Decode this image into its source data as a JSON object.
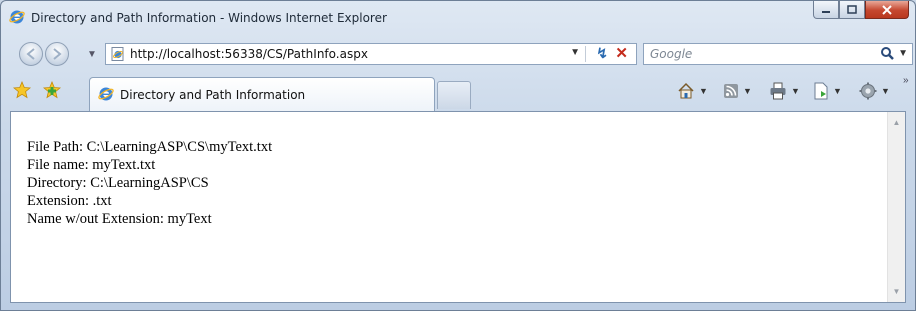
{
  "window": {
    "title": "Directory and Path Information - Windows Internet Explorer"
  },
  "nav": {
    "address": "http://localhost:56338/CS/PathInfo.aspx",
    "search_placeholder": "Google"
  },
  "tab": {
    "label": "Directory and Path Information"
  },
  "icons": {
    "favorites": "favorites-star-icon",
    "add_favorites": "add-favorites-icon",
    "home": "home-icon",
    "feeds": "feeds-icon",
    "print": "print-icon",
    "page": "page-icon",
    "tools": "tools-gear-icon"
  },
  "content": {
    "lines": [
      "File Path: C:\\LearningASP\\CS\\myText.txt",
      "File name: myText.txt",
      "Directory: C:\\LearningASP\\CS",
      "Extension: .txt",
      "Name w/out Extension: myText"
    ]
  },
  "colors": {
    "close_button": "#c5472f",
    "ie_blue": "#2a6ab0"
  }
}
